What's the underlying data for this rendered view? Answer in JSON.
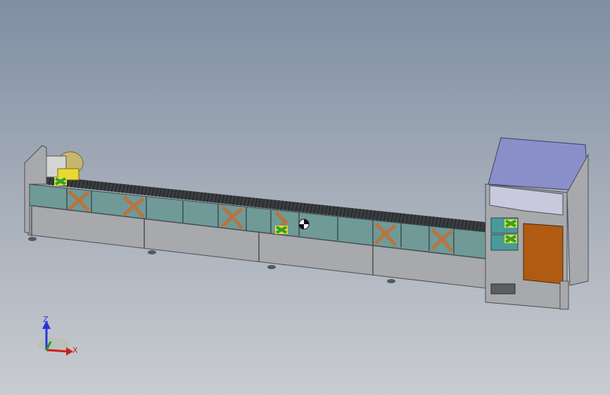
{
  "viewport": {
    "background_top": "#7f8ea3",
    "background_bottom": "#c9ccd1"
  },
  "model": {
    "frame_color": "#a7a9ad",
    "guard_panel_color": "#6f9a98",
    "cross_brace_color": "#b8743f",
    "cabinet_top_color": "#8a8fc9",
    "cabinet_door_color": "#b05a12",
    "sensor_color": "#8fd63a"
  },
  "triad": {
    "z_label": "Z",
    "x_label": "X",
    "z_color": "#2636d6",
    "x_color": "#d01f1f",
    "y_color": "#1a9c2c"
  }
}
